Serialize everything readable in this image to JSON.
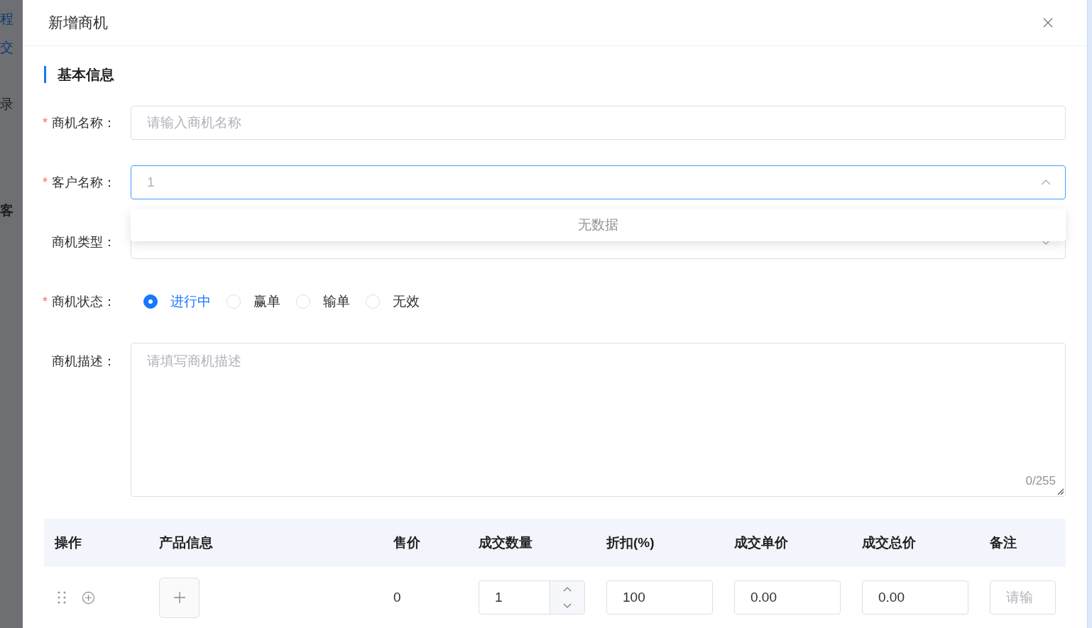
{
  "background": {
    "items": [
      "程",
      "交",
      "录",
      "客"
    ]
  },
  "dialog": {
    "title": "新增商机"
  },
  "section": {
    "title": "基本信息"
  },
  "fields": [
    {
      "kind": "input",
      "required_mark": "*",
      "label": "商机名称：",
      "placeholder": "请输入商机名称"
    },
    {
      "kind": "select",
      "required_mark": "*",
      "label": "客户名称：",
      "placeholder": "1",
      "expanded": true
    },
    {
      "kind": "select",
      "label": "商机类型：",
      "expanded": false
    },
    {
      "kind": "radio",
      "required_mark": "*",
      "label": "商机状态：",
      "options": [
        {
          "label": "进行中",
          "selected": true
        },
        {
          "label": "赢单",
          "selected": false
        },
        {
          "label": "输单",
          "selected": false
        },
        {
          "label": "无效",
          "selected": false
        }
      ]
    },
    {
      "kind": "textarea",
      "label": "商机描述：",
      "placeholder": "请填写商机描述",
      "counter": "0/255"
    }
  ],
  "dropdown": {
    "empty_text": "无数据"
  },
  "table": {
    "columns": [
      "操作",
      "产品信息",
      "售价",
      "成交数量",
      "折扣(%)",
      "成交单价",
      "成交总价",
      "备注"
    ],
    "rows": [
      {
        "price": "0",
        "quantity": "1",
        "discount": "100",
        "unit_price": "0.00",
        "total": "0.00",
        "note_placeholder": "请输"
      }
    ]
  }
}
